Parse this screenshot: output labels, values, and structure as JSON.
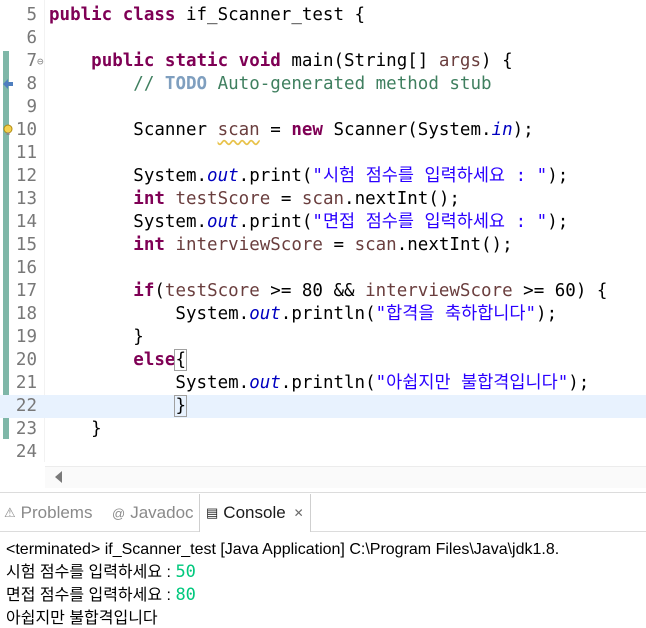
{
  "editor": {
    "lines": [
      {
        "num": "5",
        "tokens": [
          {
            "t": "public class ",
            "c": "kw"
          },
          {
            "t": "if_Scanner_test {"
          }
        ]
      },
      {
        "num": "6",
        "tokens": []
      },
      {
        "num": "7",
        "fold": "⊖",
        "tokens": [
          {
            "t": "    "
          },
          {
            "t": "public static void ",
            "c": "kw"
          },
          {
            "t": "main(String[] "
          },
          {
            "t": "args",
            "c": "var"
          },
          {
            "t": ") {"
          }
        ]
      },
      {
        "num": "8",
        "icon": "override-marker-icon",
        "tokens": [
          {
            "t": "        "
          },
          {
            "t": "// ",
            "c": "cm"
          },
          {
            "t": "TODO",
            "c": "todo"
          },
          {
            "t": " Auto-generated method stub",
            "c": "cm"
          }
        ]
      },
      {
        "num": "9",
        "tokens": []
      },
      {
        "num": "10",
        "icon": "warning-lightbulb-icon",
        "tokens": [
          {
            "t": "        Scanner "
          },
          {
            "t": "scan",
            "c": "var warn"
          },
          {
            "t": " = "
          },
          {
            "t": "new ",
            "c": "kw"
          },
          {
            "t": "Scanner(System."
          },
          {
            "t": "in",
            "c": "fld"
          },
          {
            "t": ");"
          }
        ]
      },
      {
        "num": "11",
        "tokens": []
      },
      {
        "num": "12",
        "tokens": [
          {
            "t": "        System."
          },
          {
            "t": "out",
            "c": "fld"
          },
          {
            "t": ".print("
          },
          {
            "t": "\"시험 점수를 입력하세요 : \"",
            "c": "str"
          },
          {
            "t": ");"
          }
        ]
      },
      {
        "num": "13",
        "tokens": [
          {
            "t": "        "
          },
          {
            "t": "int ",
            "c": "kw"
          },
          {
            "t": "testScore",
            "c": "var"
          },
          {
            "t": " = "
          },
          {
            "t": "scan",
            "c": "var"
          },
          {
            "t": ".nextInt();"
          }
        ]
      },
      {
        "num": "14",
        "tokens": [
          {
            "t": "        System."
          },
          {
            "t": "out",
            "c": "fld"
          },
          {
            "t": ".print("
          },
          {
            "t": "\"면접 점수를 입력하세요 : \"",
            "c": "str"
          },
          {
            "t": ");"
          }
        ]
      },
      {
        "num": "15",
        "tokens": [
          {
            "t": "        "
          },
          {
            "t": "int ",
            "c": "kw"
          },
          {
            "t": "interviewScore",
            "c": "var"
          },
          {
            "t": " = "
          },
          {
            "t": "scan",
            "c": "var"
          },
          {
            "t": ".nextInt();"
          }
        ]
      },
      {
        "num": "16",
        "tokens": []
      },
      {
        "num": "17",
        "tokens": [
          {
            "t": "        "
          },
          {
            "t": "if",
            "c": "kw"
          },
          {
            "t": "("
          },
          {
            "t": "testScore",
            "c": "var"
          },
          {
            "t": " >= 80 && "
          },
          {
            "t": "interviewScore",
            "c": "var"
          },
          {
            "t": " >= 60) {"
          }
        ]
      },
      {
        "num": "18",
        "tokens": [
          {
            "t": "            System."
          },
          {
            "t": "out",
            "c": "fld"
          },
          {
            "t": ".println("
          },
          {
            "t": "\"합격을 축하합니다\"",
            "c": "str"
          },
          {
            "t": ");"
          }
        ]
      },
      {
        "num": "19",
        "tokens": [
          {
            "t": "        }"
          }
        ]
      },
      {
        "num": "20",
        "tokens": [
          {
            "t": "        "
          },
          {
            "t": "else",
            "c": "kw"
          },
          {
            "t": "{",
            "c": "bracket-box"
          }
        ]
      },
      {
        "num": "21",
        "tokens": [
          {
            "t": "            System."
          },
          {
            "t": "out",
            "c": "fld"
          },
          {
            "t": ".println("
          },
          {
            "t": "\"아쉽지만 불합격입니다\"",
            "c": "str"
          },
          {
            "t": ");"
          }
        ]
      },
      {
        "num": "22",
        "current": true,
        "tokens": [
          {
            "t": "            "
          },
          {
            "t": "}",
            "c": "bracket-box"
          },
          {
            "caret": true
          }
        ]
      },
      {
        "num": "23",
        "tokens": [
          {
            "t": "    }"
          }
        ]
      },
      {
        "num": "24",
        "tokens": []
      }
    ]
  },
  "panel": {
    "tabs": [
      {
        "label": "Problems",
        "icon": "problems-icon",
        "glyph": "⚠",
        "active": false
      },
      {
        "label": "Javadoc",
        "icon": "javadoc-icon",
        "glyph": "@",
        "active": false
      },
      {
        "label": "Console",
        "icon": "console-icon",
        "glyph": "▤",
        "active": true,
        "close": "✕"
      }
    ]
  },
  "console": {
    "header": "<terminated> if_Scanner_test [Java Application] C:\\Program Files\\Java\\jdk1.8.",
    "output": [
      {
        "prompt": "시험 점수를 입력하세요 : ",
        "input": "50"
      },
      {
        "prompt": "면접 점수를 입력하세요 : ",
        "input": "80"
      },
      {
        "prompt": "아쉽지만 불합격입니다",
        "input": ""
      }
    ]
  },
  "colors": {
    "keyword": "#7f0055",
    "comment": "#3f7f5f",
    "string": "#2a00ff",
    "field": "#0000c0",
    "variable": "#6a3e3e",
    "console_input": "#00c87d",
    "current_line": "#e8f2fe"
  }
}
